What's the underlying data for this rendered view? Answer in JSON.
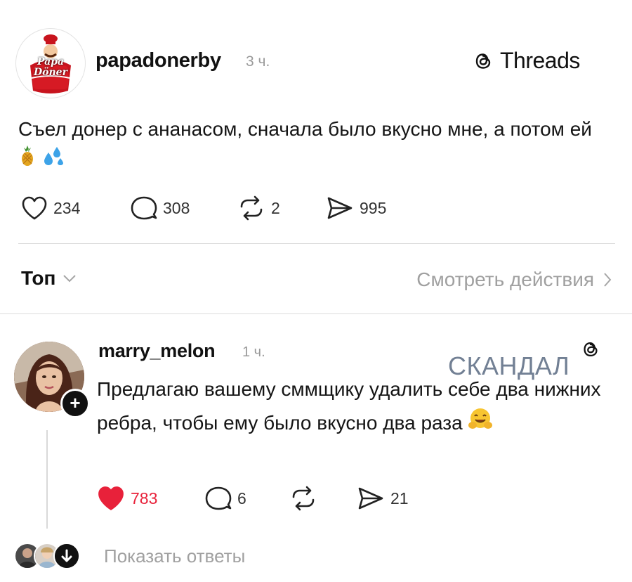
{
  "post": {
    "avatar_logo_line1": "Papa",
    "avatar_logo_line2": "Döner",
    "username": "papadonerby",
    "time": "3 ч.",
    "brand": "Threads",
    "text": "Съел донер с ананасом, сначала было вкусно мне, а потом ей",
    "emoji": [
      "pineapple",
      "sweat-droplets"
    ],
    "likes": "234",
    "comments": "308",
    "reposts": "2",
    "shares": "995"
  },
  "sort": {
    "label": "Топ",
    "view_activity": "Смотреть действия"
  },
  "reply": {
    "username": "marry_melon",
    "time": "1 ч.",
    "watermark": "СКАНДАЛ",
    "text": "Предлагаю вашему сммщику удалить себе два нижних ребра, чтобы ему было вкусно два раза",
    "emoji": "hugging-face",
    "likes": "783",
    "liked": true,
    "comments": "6",
    "shares": "21",
    "like_color": "#e8213a"
  },
  "show_replies": {
    "label": "Показать ответы"
  },
  "icons": [
    "threads-logo-icon",
    "heart-icon",
    "comment-icon",
    "repost-icon",
    "share-icon",
    "chevron-down-icon",
    "chevron-right-icon",
    "plus-icon",
    "arrow-down-icon"
  ]
}
